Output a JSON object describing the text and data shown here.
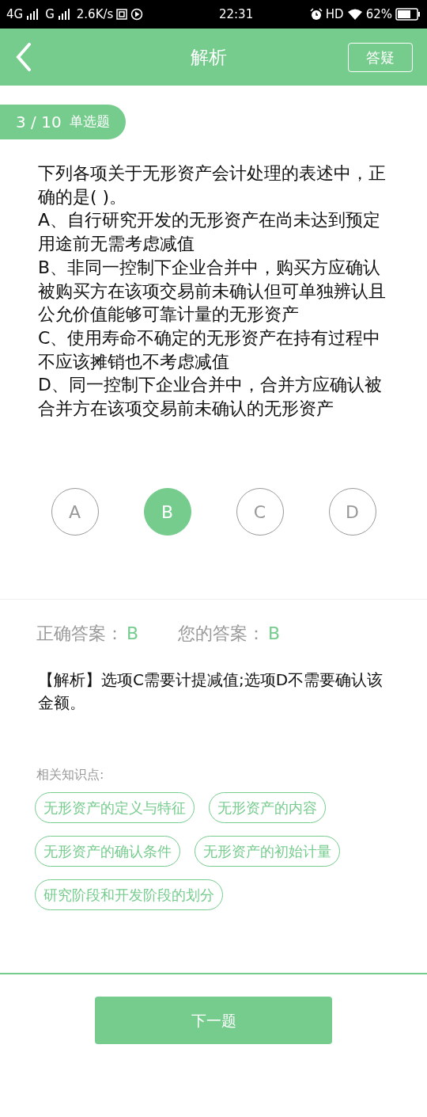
{
  "status_bar": {
    "network_1": "4G",
    "network_2": "G",
    "speed": "2.6K/s",
    "time": "22:31",
    "hd": "HD",
    "battery": "62%"
  },
  "header": {
    "title": "解析",
    "action": "答疑"
  },
  "question": {
    "progress": "3 / 10",
    "type": "单选题",
    "paragraphs": [
      "下列各项关于无形资产会计处理的表述中，正确的是( )。",
      "A、自行研究开发的无形资产在尚未达到预定用途前无需考虑减值",
      "B、非同一控制下企业合并中，购买方应确认被购买方在该项交易前未确认但可单独辨认且公允价值能够可靠计量的无形资产",
      "C、使用寿命不确定的无形资产在持有过程中不应该摊销也不考虑减值",
      "D、同一控制下企业合并中，合并方应确认被合并方在该项交易前未确认的无形资产"
    ]
  },
  "options": [
    {
      "label": "A",
      "selected": false
    },
    {
      "label": "B",
      "selected": true
    },
    {
      "label": "C",
      "selected": false
    },
    {
      "label": "D",
      "selected": false
    }
  ],
  "answer": {
    "correct_label": "正确答案：",
    "correct": "B",
    "yours_label": "您的答案：",
    "yours": "B"
  },
  "analysis": "【解析】选项C需要计提减值;选项D不需要确认该金额。",
  "knowledge": {
    "label": "相关知识点:",
    "tags": [
      "无形资产的定义与特征",
      "无形资产的内容",
      "无形资产的确认条件",
      "无形资产的初始计量",
      "研究阶段和开发阶段的划分"
    ]
  },
  "next_button": "下一题"
}
